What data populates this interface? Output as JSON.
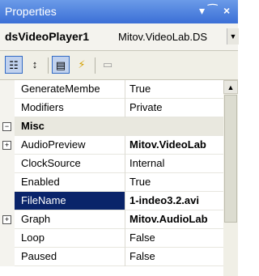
{
  "panel": {
    "title": "Properties",
    "pin_label": "↓ ⁀",
    "close_label": "×"
  },
  "object": {
    "name": "dsVideoPlayer1",
    "type": "Mitov.VideoLab.DS"
  },
  "toolbar": {
    "categorized_label": "☷",
    "alphabetical_label": "↕",
    "properties_label": "▤",
    "events_label": "⚡",
    "pages_label": "▭"
  },
  "rows": [
    {
      "name": "GenerateMembe",
      "value": "True",
      "value_bold": false
    },
    {
      "name": "Modifiers",
      "value": "Private",
      "value_bold": false
    },
    {
      "name": "Misc",
      "value": "",
      "category": true
    },
    {
      "name": "AudioPreview",
      "value": "Mitov.VideoLab",
      "value_bold": true,
      "expandable": true
    },
    {
      "name": "ClockSource",
      "value": "Internal",
      "value_bold": false
    },
    {
      "name": "Enabled",
      "value": "True",
      "value_bold": false
    },
    {
      "name": "FileName",
      "value": "1-indeo3.2.avi",
      "value_bold": true,
      "selected": true
    },
    {
      "name": "Graph",
      "value": "Mitov.AudioLab",
      "value_bold": true,
      "expandable": true
    },
    {
      "name": "Loop",
      "value": "False",
      "value_bold": false
    },
    {
      "name": "Paused",
      "value": "False",
      "value_bold": false
    }
  ],
  "icons": {
    "expand": "plus-icon",
    "collapse": "minus-icon",
    "scroll_up": "up-arrow-icon",
    "dropdown": "chevron-down-icon"
  }
}
